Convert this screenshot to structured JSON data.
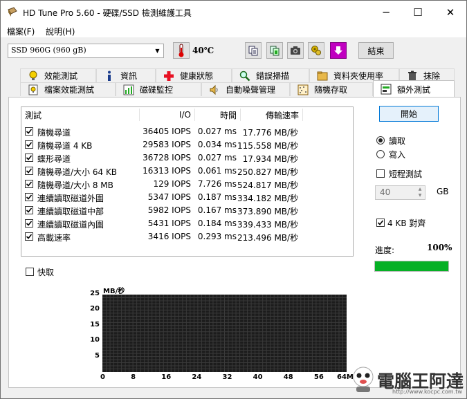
{
  "window": {
    "title": "HD Tune Pro 5.60 - 硬碟/SSD 檢測維護工具",
    "minimize": "─",
    "maximize": "☐",
    "close": "✕"
  },
  "menu": {
    "file": "檔案(F)",
    "help": "說明(H)"
  },
  "toolbar": {
    "drive": "SSD 960G (960 gB)",
    "temperature": "40℃",
    "exit_label": "結束"
  },
  "tabs_row1": [
    "效能測試",
    "資訊",
    "健康狀態",
    "錯誤掃描",
    "資料夾使用率",
    "抹除"
  ],
  "tabs_row2": [
    "檔案效能測試",
    "磁碟監控",
    "自動噪聲管理",
    "隨機存取",
    "額外測試"
  ],
  "active_tab": "額外測試",
  "table": {
    "headers": [
      "測試",
      "I/O",
      "時間",
      "傳輸速率"
    ],
    "rows": [
      {
        "name": "隨機尋道",
        "io": "36405 IOPS",
        "time": "0.027 ms",
        "rate": "17.776 MB/秒",
        "checked": true
      },
      {
        "name": "隨機尋道 4 KB",
        "io": "29583 IOPS",
        "time": "0.034 ms",
        "rate": "115.558 MB/秒",
        "checked": true
      },
      {
        "name": "蝶形尋道",
        "io": "36728 IOPS",
        "time": "0.027 ms",
        "rate": "17.934 MB/秒",
        "checked": true
      },
      {
        "name": "隨機尋道/大小 64 KB",
        "io": "16313 IOPS",
        "time": "0.061 ms",
        "rate": "250.827 MB/秒",
        "checked": true
      },
      {
        "name": "隨機尋道/大小 8 MB",
        "io": "129 IOPS",
        "time": "7.726 ms",
        "rate": "524.817 MB/秒",
        "checked": true
      },
      {
        "name": "連續讀取磁道外圍",
        "io": "5347 IOPS",
        "time": "0.187 ms",
        "rate": "334.182 MB/秒",
        "checked": true
      },
      {
        "name": "連續讀取磁道中部",
        "io": "5982 IOPS",
        "time": "0.167 ms",
        "rate": "373.890 MB/秒",
        "checked": true
      },
      {
        "name": "連續讀取磁道內圍",
        "io": "5431 IOPS",
        "time": "0.184 ms",
        "rate": "339.433 MB/秒",
        "checked": true
      },
      {
        "name": "高載速率",
        "io": "3416 IOPS",
        "time": "0.293 ms",
        "rate": "213.496 MB/秒",
        "checked": true
      }
    ]
  },
  "side": {
    "start": "開始",
    "read": "讀取",
    "write": "寫入",
    "short_test": "短程測試",
    "size_value": "40",
    "size_unit": "GB",
    "align_4kb": "4 KB 對齊",
    "progress_label": "進度:",
    "progress_text": "100%",
    "progress_value": 1.0
  },
  "fast_label": "快取",
  "chart_data": {
    "type": "line",
    "ylabel": "MB/秒",
    "yticks": [
      "25",
      "20",
      "15",
      "10",
      "5"
    ],
    "xticks": [
      "0",
      "8",
      "16",
      "24",
      "32",
      "40",
      "48",
      "56",
      "64MB"
    ],
    "ylim": [
      0,
      25
    ],
    "xlim": [
      0,
      64
    ],
    "series": [],
    "grid": true,
    "background": "#1c1c1c"
  },
  "watermark": {
    "text": "電腦王阿達",
    "url": "http://www.kocpc.com.tw"
  },
  "colors": {
    "progress": "#06b025",
    "accent_button_border": "#0078d7",
    "health_cross": "#e81123"
  }
}
